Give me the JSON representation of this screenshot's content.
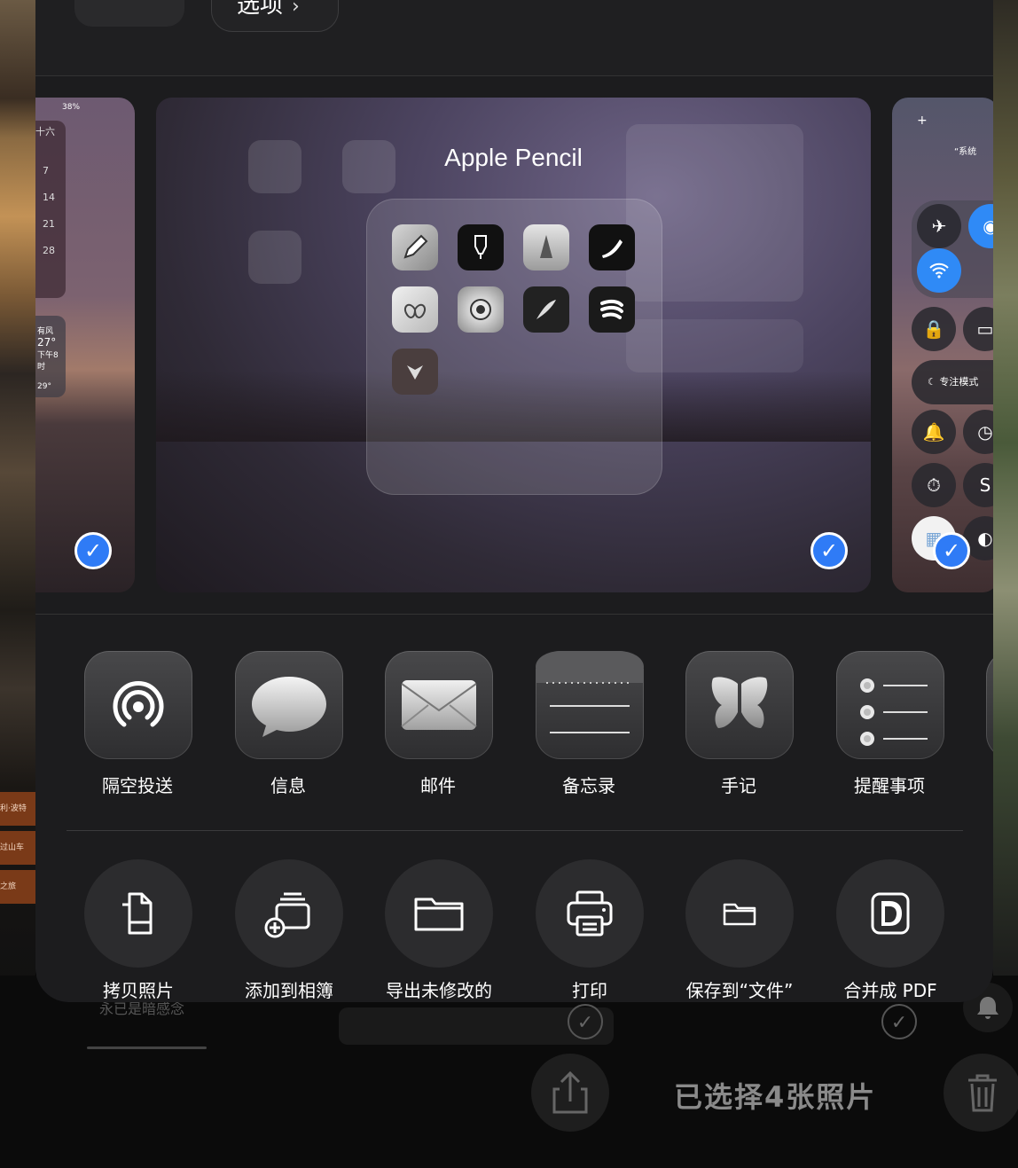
{
  "background": {
    "tags": [
      "利·波特",
      "过山车",
      "之旅"
    ],
    "partial_text": "永已是暗感念",
    "selected_count_label": "已选择4张照片"
  },
  "sheet": {
    "options_label": "选项",
    "options_chevron": "›",
    "previews": {
      "left": {
        "status": "38%",
        "calendar_header": "十六",
        "calendar_days": [
          "7",
          "14",
          "21",
          "28"
        ],
        "weather_wind": "有风",
        "weather_temp": "27°",
        "weather_time": "下午8时",
        "weather_low": "29°"
      },
      "center": {
        "folder_title": "Apple Pencil",
        "apps": [
          "pencil-app-icon",
          "marker-app-icon",
          "vectornator-app-icon",
          "procreate-app-icon",
          "coloring-book-app-icon",
          "mandala-app-icon",
          "sketch-app-icon",
          "brush-app-icon",
          "concepts-app-icon"
        ]
      },
      "right": {
        "header": "“系统",
        "focus_label": "专注模式"
      }
    },
    "check_glyph": "✓",
    "apps_row": [
      {
        "label": "隔空投送",
        "icon": "airdrop-icon"
      },
      {
        "label": "信息",
        "icon": "messages-icon"
      },
      {
        "label": "邮件",
        "icon": "mail-icon"
      },
      {
        "label": "备忘录",
        "icon": "notes-icon"
      },
      {
        "label": "手记",
        "icon": "journal-icon"
      },
      {
        "label": "提醒事项",
        "icon": "reminders-icon"
      }
    ],
    "actions_row": [
      {
        "label": "拷贝照片",
        "icon": "copy-icon"
      },
      {
        "label": "添加到相簿",
        "icon": "add-to-album-icon"
      },
      {
        "label": "导出未修改的",
        "icon": "folder-icon"
      },
      {
        "label": "打印",
        "icon": "printer-icon"
      },
      {
        "label": "保存到“文件”",
        "icon": "files-icon"
      },
      {
        "label": "合并成 PDF",
        "icon": "pdf-icon"
      }
    ]
  }
}
